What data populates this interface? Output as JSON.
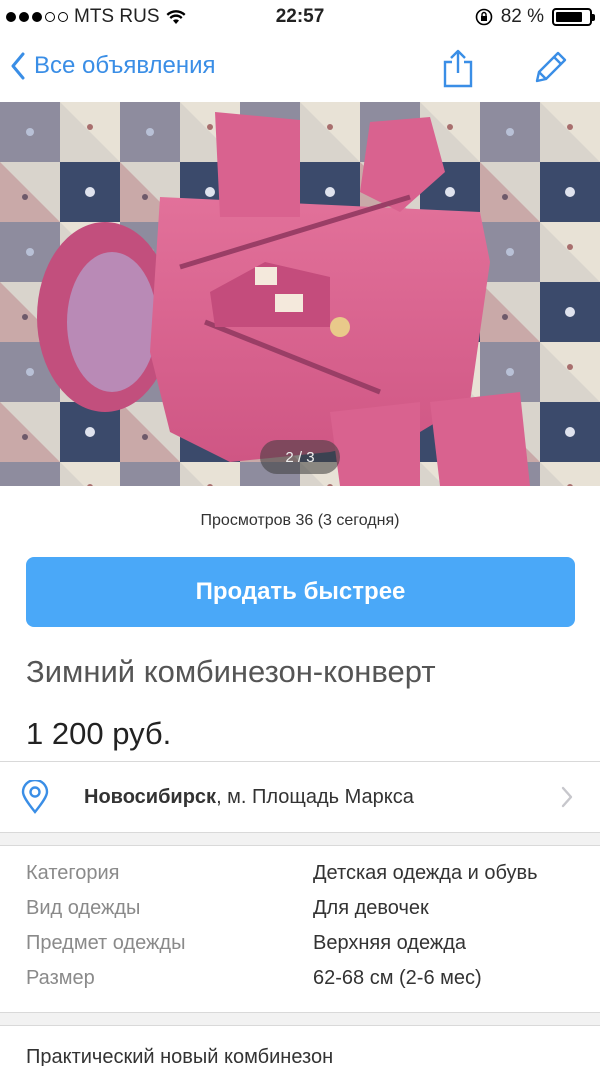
{
  "status_bar": {
    "carrier": "MTS RUS",
    "time": "22:57",
    "battery": "82 %",
    "battery_level": 0.82,
    "signal_bars": 3
  },
  "nav": {
    "back_label": "Все объявления",
    "icons": [
      "chevron-left-icon",
      "share-icon",
      "pencil-icon"
    ],
    "accent": "#3a8ee6"
  },
  "photo": {
    "counter": "2 / 3"
  },
  "listing": {
    "views": "Просмотров 36 (3 сегодня)",
    "sell_faster_label": "Продать быстрее",
    "title": "Зимний комбинезон-конверт",
    "price": "1 200 руб.",
    "city": "Новосибирск",
    "metro": ", м. Площадь Маркса",
    "description_start": "Практический новый комбинезон"
  },
  "params": [
    {
      "label": "Категория",
      "value": "Детская одежда и обувь"
    },
    {
      "label": "Вид одежды",
      "value": "Для девочек"
    },
    {
      "label": "Предмет одежды",
      "value": "Верхняя одежда"
    },
    {
      "label": "Размер",
      "value": "62-68 см (2-6 мес)"
    }
  ],
  "colors": {
    "button": "#4aa8f8",
    "accent": "#3a8ee6",
    "muted": "#8a8a8a"
  }
}
